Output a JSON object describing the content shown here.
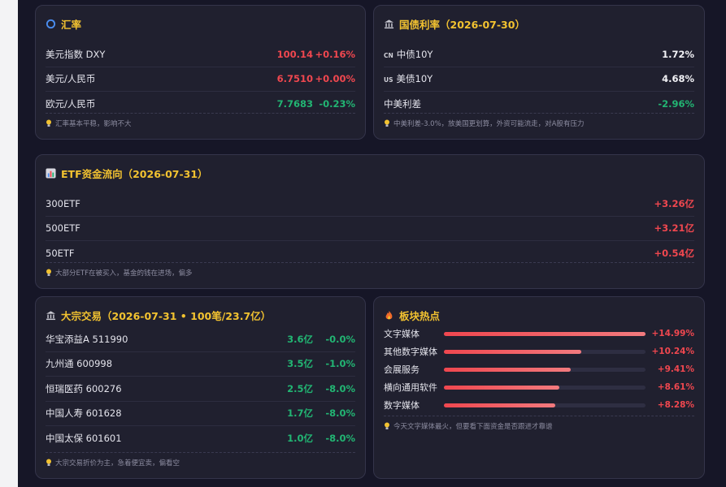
{
  "colors": {
    "up": "#f0474f",
    "down": "#22b573",
    "title": "#f2c230"
  },
  "fx": {
    "title": "汇率",
    "icon": "refresh-icon",
    "rows": [
      {
        "name": "美元指数 DXY",
        "value": "100.14",
        "change": "+0.16%",
        "color": "red"
      },
      {
        "name": "美元/人民币",
        "value": "6.7510",
        "change": "+0.00%",
        "color": "red"
      },
      {
        "name": "欧元/人民币",
        "value": "7.7683",
        "change": "-0.23%",
        "color": "green"
      }
    ],
    "note": "汇率基本平稳，影响不大"
  },
  "bonds": {
    "title": "国债利率（2026-07-30）",
    "icon": "bank-icon",
    "rows": [
      {
        "flag": "CN",
        "name": "中债10Y",
        "value": "1.72%",
        "color": "white"
      },
      {
        "flag": "US",
        "name": "美债10Y",
        "value": "4.68%",
        "color": "white"
      },
      {
        "flag": "",
        "name": "中美利差",
        "value": "-2.96%",
        "color": "green"
      }
    ],
    "note": "中美利差-3.0%，放美国更划算，外资可能流走，对A股有压力"
  },
  "etf": {
    "title": "ETF资金流向（2026-07-31）",
    "icon": "bar-chart-icon",
    "rows": [
      {
        "name": "300ETF",
        "value": "+3.26亿"
      },
      {
        "name": "500ETF",
        "value": "+3.21亿"
      },
      {
        "name": "50ETF",
        "value": "+0.54亿"
      }
    ],
    "note": "大部分ETF在被买入，基金的钱在进场，偏多"
  },
  "block": {
    "title": "大宗交易（2026-07-31 • 100笔/23.7亿）",
    "icon": "bank-icon",
    "rows": [
      {
        "name": "华宝添益A 511990",
        "amount": "3.6亿",
        "discount": "-0.0%"
      },
      {
        "name": "九州通 600998",
        "amount": "3.5亿",
        "discount": "-1.0%"
      },
      {
        "name": "恒瑞医药 600276",
        "amount": "2.5亿",
        "discount": "-8.0%"
      },
      {
        "name": "中国人寿 601628",
        "amount": "1.7亿",
        "discount": "-8.0%"
      },
      {
        "name": "中国太保 601601",
        "amount": "1.0亿",
        "discount": "-8.0%"
      }
    ],
    "note": "大宗交易折价为主，急着便宜卖，偏看空"
  },
  "sectors": {
    "title": "板块热点",
    "icon": "fire-icon",
    "rows": [
      {
        "name": "文字媒体",
        "pct": "+14.99%",
        "fill": 1.0
      },
      {
        "name": "其他数字媒体",
        "pct": "+10.24%",
        "fill": 0.683
      },
      {
        "name": "会展服务",
        "pct": "+9.41%",
        "fill": 0.628
      },
      {
        "name": "横向通用软件",
        "pct": "+8.61%",
        "fill": 0.574
      },
      {
        "name": "数字媒体",
        "pct": "+8.28%",
        "fill": 0.552
      }
    ],
    "note": "今天文字媒体最火，但要看下面资金是否跟进才靠谱"
  }
}
